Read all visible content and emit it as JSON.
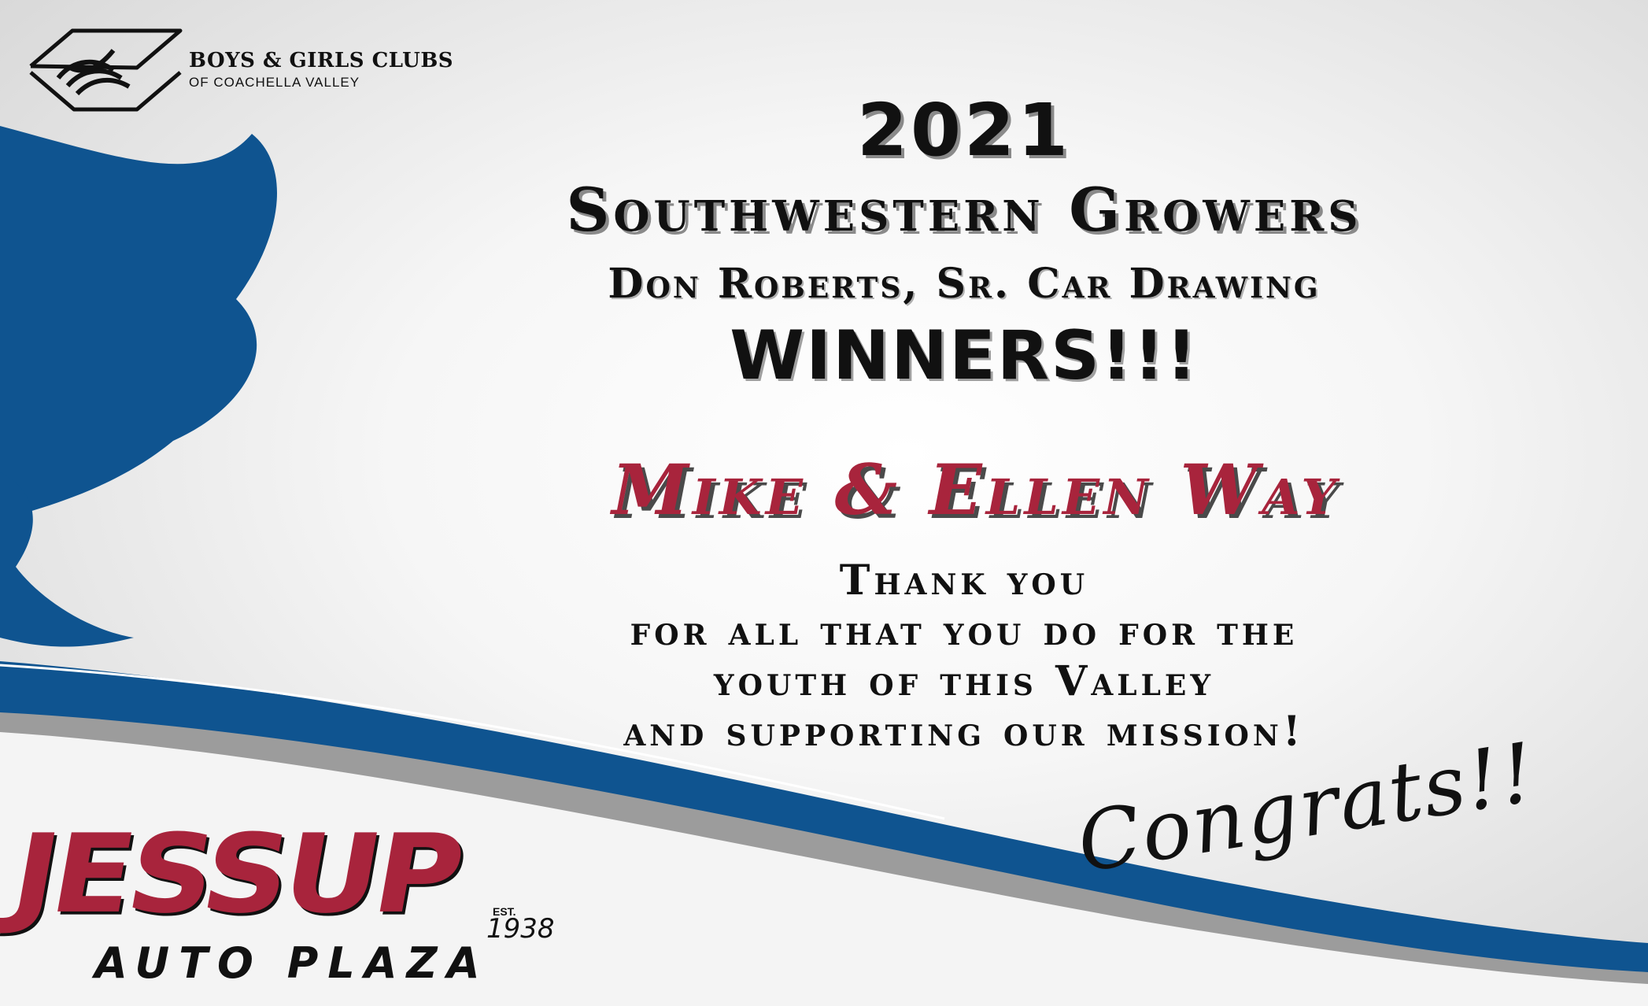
{
  "org": {
    "name": "BOYS & GIRLS CLUBS",
    "subtitle": "OF COACHELLA VALLEY"
  },
  "headline": {
    "year": "2021",
    "event": "Southwestern Growers",
    "drawing": "Don Roberts, Sr. Car Drawing",
    "winners": "WINNERS!!!"
  },
  "winner_names": "Mike & Ellen Way",
  "thanks": {
    "line1": "Thank you",
    "line2": "for all that you do for the",
    "line3": "youth of this Valley",
    "line4": "and supporting our mission!"
  },
  "congrats": "Congrats!!",
  "sponsor": {
    "name": "JESSUP",
    "est_label": "EST.",
    "est_year": "1938",
    "tagline": "AUTO PLAZA"
  },
  "colors": {
    "brand_blue": "#0f5490",
    "accent_red": "#a8243c",
    "swoosh_gray": "#9a9a9a",
    "text_dark": "#111111"
  }
}
